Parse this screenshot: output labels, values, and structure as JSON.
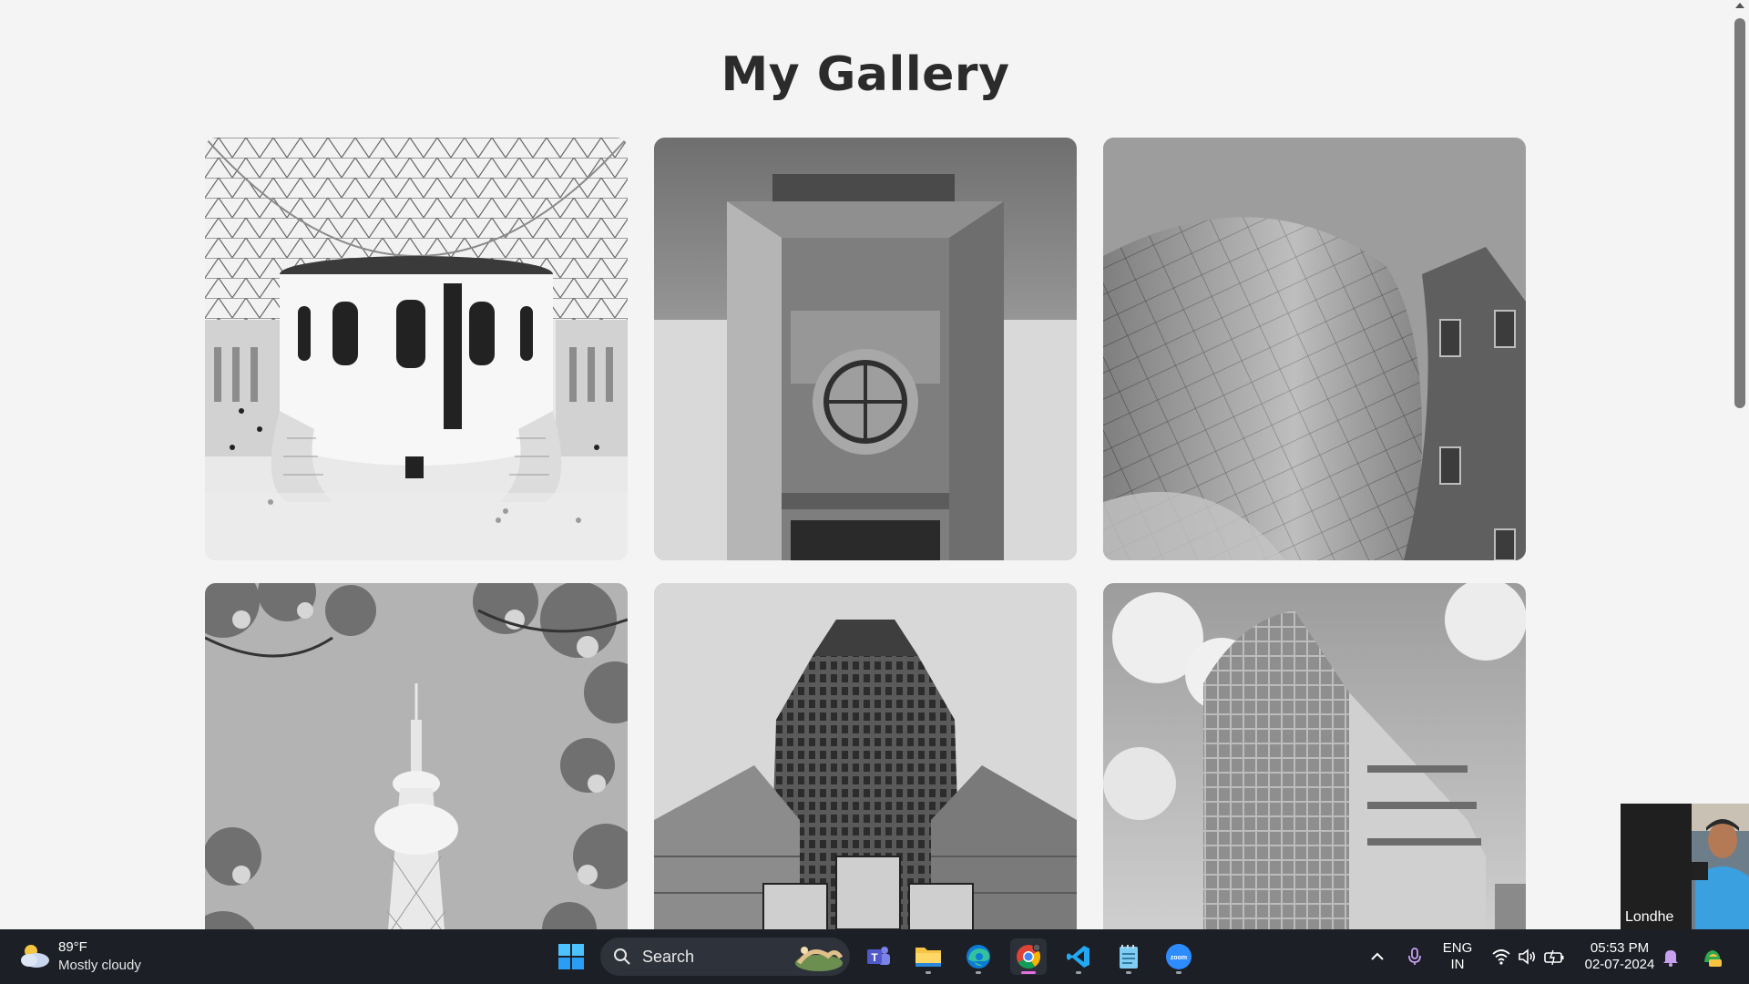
{
  "page": {
    "title": "My Gallery",
    "images": [
      {
        "subject": "domed-atrium"
      },
      {
        "subject": "round-window-facade"
      },
      {
        "subject": "curved-metal-facade"
      },
      {
        "subject": "tv-tower-blossoms"
      },
      {
        "subject": "stepped-skyscraper"
      },
      {
        "subject": "glass-office-building"
      }
    ]
  },
  "video_call": {
    "participant_name": "Londhe"
  },
  "taskbar": {
    "weather": {
      "temperature": "89°F",
      "condition": "Mostly cloudy"
    },
    "search": {
      "label": "Search"
    },
    "apps": [
      "start-icon",
      "teams-icon",
      "file-explorer-icon",
      "edge-icon",
      "chrome-icon",
      "vscode-icon",
      "notepad-icon",
      "zoom-icon"
    ],
    "tray": {
      "language_line1": "ENG",
      "language_line2": "IN",
      "time": "05:53 PM",
      "date": "02-07-2024"
    }
  },
  "colors": {
    "page_background": "#f4f4f4",
    "title": "#2b2b2b",
    "taskbar": "#1c1f26",
    "active_indicator": "#e36fe0"
  }
}
